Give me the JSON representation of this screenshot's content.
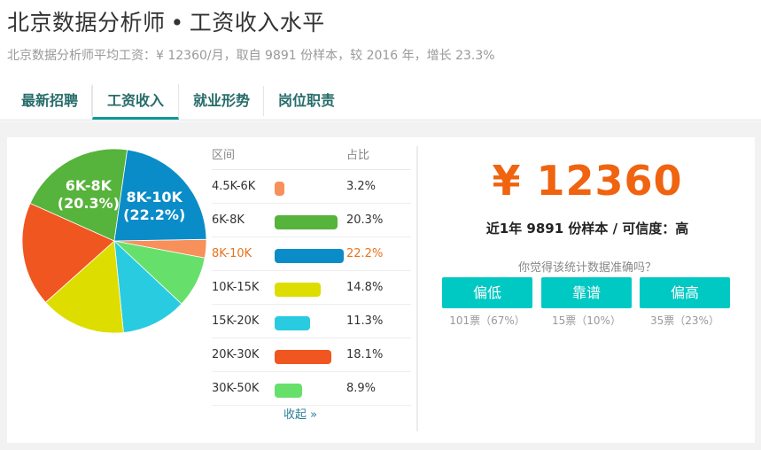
{
  "header": {
    "title_left": "北京数据分析师",
    "title_dot": "•",
    "title_right": "工资收入水平",
    "subtitle": "北京数据分析师平均工资：¥ 12360/月，取自 9891 份样本，较 2016 年，增长 23.3%"
  },
  "tabs": [
    {
      "label": "最新招聘",
      "active": false
    },
    {
      "label": "工资收入",
      "active": true
    },
    {
      "label": "就业形势",
      "active": false
    },
    {
      "label": "岗位职责",
      "active": false
    }
  ],
  "table": {
    "col_range": "区间",
    "col_ratio": "占比",
    "highlight_index": 2,
    "collapse_label": "收起 »"
  },
  "chart_data": {
    "type": "pie",
    "categories": [
      "4.5K-6K",
      "6K-8K",
      "8K-10K",
      "10K-15K",
      "15K-20K",
      "20K-30K",
      "30K-50K"
    ],
    "values": [
      3.2,
      20.3,
      22.2,
      14.8,
      11.3,
      18.1,
      8.9
    ],
    "value_labels": [
      "3.2%",
      "20.3%",
      "22.2%",
      "14.8%",
      "11.3%",
      "18.1%",
      "8.9%"
    ],
    "colors": [
      "#f7905a",
      "#56b33b",
      "#0a8cc8",
      "#dedd00",
      "#29cbe0",
      "#f05620",
      "#66e06a"
    ],
    "slice_labels": [
      {
        "index": 1,
        "name": "6K-8K",
        "pct": "(20.3%)"
      },
      {
        "index": 2,
        "name": "8K-10K",
        "pct": "(22.2%)"
      }
    ]
  },
  "summary": {
    "salary": "¥ 12360",
    "sample_text": "近1年 9891 份样本 / 可信度：高",
    "question": "你觉得该统计数据准确吗？"
  },
  "votes": [
    {
      "label": "偏低",
      "count": "101票（67%）"
    },
    {
      "label": "靠谱",
      "count": "15票（10%）"
    },
    {
      "label": "偏高",
      "count": "35票（23%）"
    }
  ]
}
